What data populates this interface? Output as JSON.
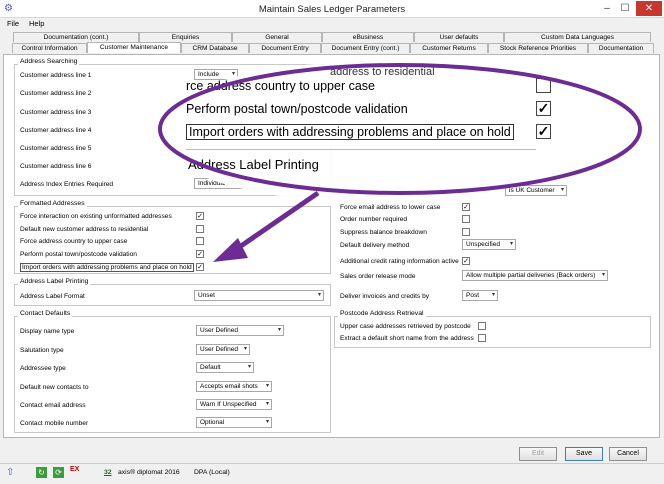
{
  "window": {
    "title": "Maintain Sales Ledger Parameters"
  },
  "menu": [
    "File",
    "Help"
  ],
  "tabs_row1": [
    "Documentation (cont.)",
    "Enquiries",
    "General",
    "eBusiness",
    "User defaults",
    "Custom Data Languages"
  ],
  "tabs_row2": [
    "Control Information",
    "Customer Maintenance",
    "CRM Database",
    "Document Entry",
    "Document Entry (cont.)",
    "Customer Returns",
    "Stock Reference Priorities",
    "Documentation"
  ],
  "address_searching": {
    "title": "Address Searching",
    "lines": [
      {
        "label": "Customer address line 1",
        "value": "Include"
      },
      {
        "label": "Customer address line 2",
        "value": ""
      },
      {
        "label": "Customer address line 3",
        "value": ""
      },
      {
        "label": "Customer address line 4",
        "value": ""
      },
      {
        "label": "Customer address line 5",
        "value": ""
      },
      {
        "label": "Customer address line 6",
        "value": ""
      }
    ],
    "index_label": "Address Index Entries Required",
    "index_value": "Individual Words"
  },
  "formatted_addresses": {
    "title": "Formatted Addresses",
    "items": [
      {
        "label": "Force interaction on existing unformatted addresses",
        "checked": "✓"
      },
      {
        "label": "Default new customer address to residential",
        "checked": ""
      },
      {
        "label": "Force address country to upper case",
        "checked": ""
      },
      {
        "label": "Perform postal town/postcode validation",
        "checked": "✓"
      },
      {
        "label": "Import orders with addressing problems and place on hold",
        "checked": "✓"
      }
    ]
  },
  "zoom": {
    "partial_top": "address to residential",
    "items": [
      {
        "label": "rce address country to upper case",
        "checked": ""
      },
      {
        "label": "Perform postal town/postcode validation",
        "checked": "✓"
      },
      {
        "label": "Import orders with addressing problems and place on hold",
        "checked": "✓"
      }
    ],
    "heading": "Address Label Printing"
  },
  "address_label": {
    "title": "Address Label Printing",
    "format_label": "Address Label Format",
    "format_value": "Unset"
  },
  "contact_defaults": {
    "title": "Contact Defaults",
    "fields": [
      {
        "label": "Display name type",
        "value": "User Defined"
      },
      {
        "label": "Salutation type",
        "value": "User Defined"
      },
      {
        "label": "Addressee type",
        "value": "Default"
      },
      {
        "label": "Default new contacts to",
        "value": "Accepts email shots"
      },
      {
        "label": "Contact email address",
        "value": "Warn If Unspecified"
      },
      {
        "label": "Contact mobile number",
        "value": "Optional"
      }
    ]
  },
  "right_top_combo": "is UK Customer",
  "right_options": {
    "checks": [
      {
        "label": "Force email address to lower case",
        "checked": "✓"
      },
      {
        "label": "Order number required",
        "checked": ""
      },
      {
        "label": "Suppress balance breakdown",
        "checked": ""
      }
    ],
    "delivery_label": "Default delivery method",
    "delivery_value": "Unspecified",
    "credit_label": "Additional credit rating information active",
    "credit_checked": "✓",
    "release_label": "Sales order release mode",
    "release_value": "Allow multiple partial deliveries (Back orders)",
    "deliver_label": "Deliver invoices and credits by",
    "deliver_value": "Post"
  },
  "postcode": {
    "title": "Postcode Address Retrieval",
    "items": [
      {
        "label": "Upper case addresses retrieved by postcode",
        "checked": ""
      },
      {
        "label": "Extract a default short name from the address",
        "checked": ""
      }
    ]
  },
  "buttons": {
    "edit": "Edit",
    "save": "Save",
    "cancel": "Cancel"
  },
  "status": {
    "count": "32",
    "product": "axis® diplomat 2016",
    "db": "DPA (Local)"
  }
}
